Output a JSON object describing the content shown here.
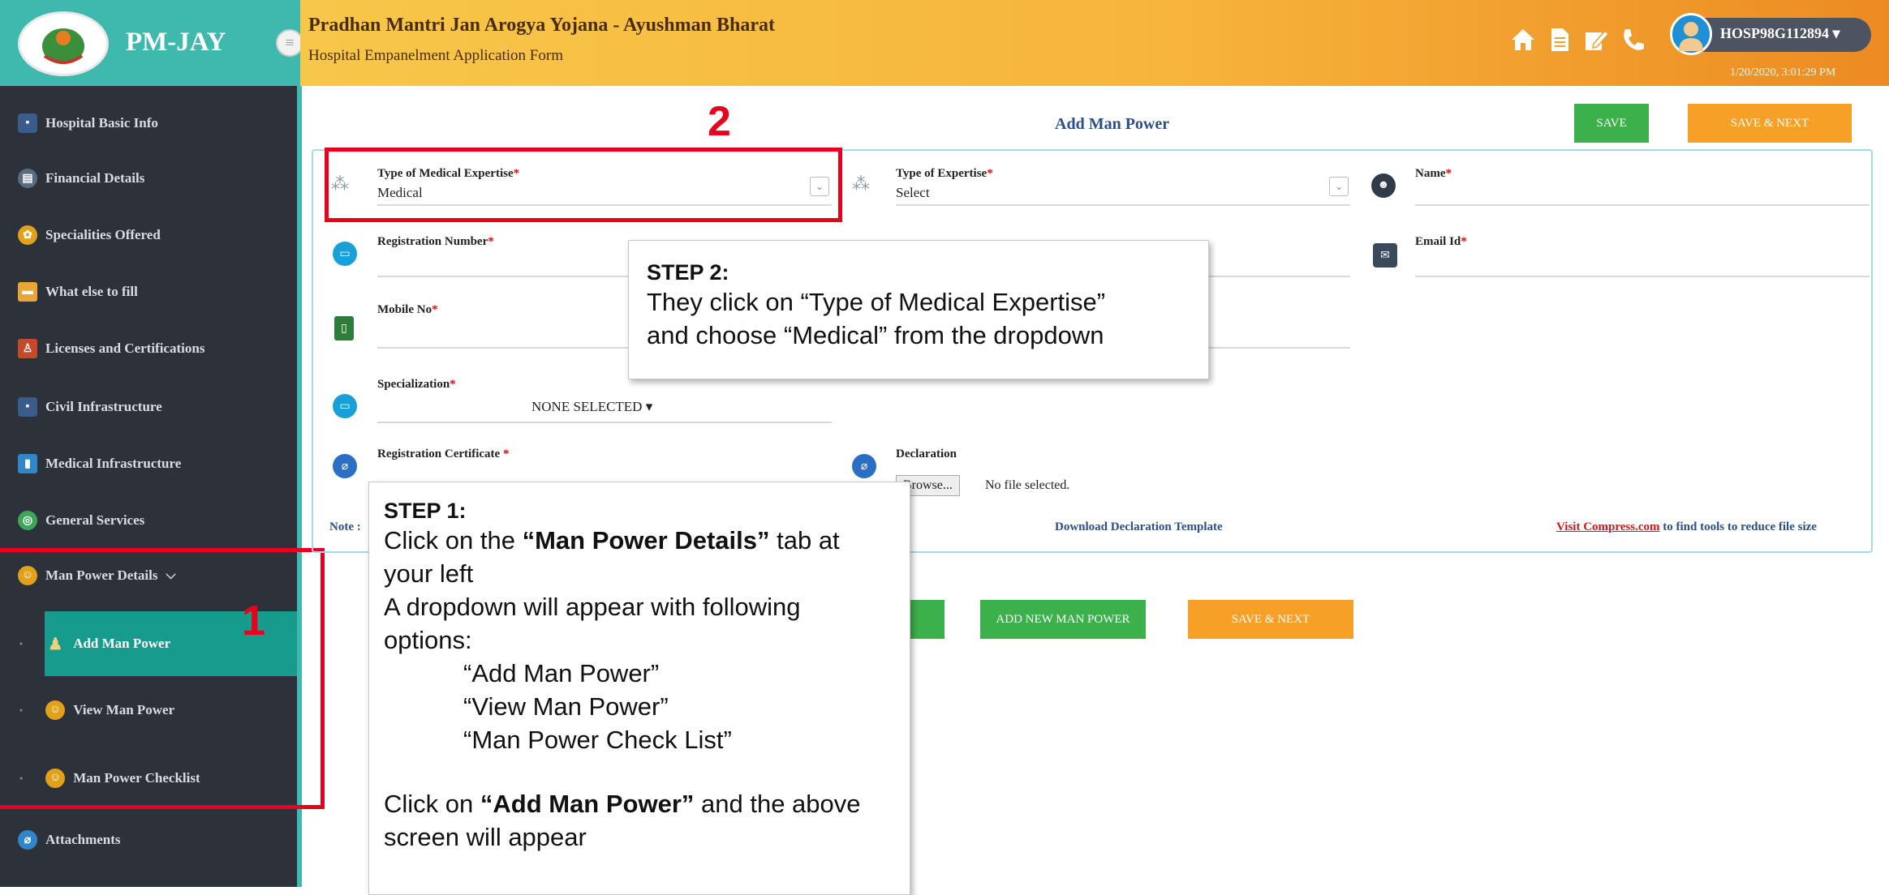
{
  "header": {
    "logo_text": "PM-JAY",
    "title": "Pradhan Mantri Jan Arogya Yojana - Ayushman Bharat",
    "subtitle": "Hospital Empanelment Application Form",
    "user_id": "HOSP98G112894",
    "timestamp": "1/20/2020, 3:01:29 PM",
    "icons": [
      "home-icon",
      "document-icon",
      "edit-icon",
      "phone-icon"
    ]
  },
  "sidebar": {
    "items": [
      {
        "label": "Hospital Basic Info",
        "icon": "hospital-icon"
      },
      {
        "label": "Financial Details",
        "icon": "bank-icon"
      },
      {
        "label": "Specialities Offered",
        "icon": "speciality-icon"
      },
      {
        "label": "What else to fill",
        "icon": "folder-icon"
      },
      {
        "label": "Licenses and Certifications",
        "icon": "certificate-icon"
      },
      {
        "label": "Civil Infrastructure",
        "icon": "building-icon"
      },
      {
        "label": "Medical Infrastructure",
        "icon": "medical-icon"
      },
      {
        "label": "General Services",
        "icon": "services-icon"
      },
      {
        "label": "Man Power Details",
        "icon": "manpower-icon"
      }
    ],
    "sub_items": [
      {
        "label": "Add Man Power",
        "active": true
      },
      {
        "label": "View Man Power",
        "active": false
      },
      {
        "label": "Man Power Checklist",
        "active": false
      }
    ],
    "last_item": "Attachments"
  },
  "form": {
    "title": "Add Man Power",
    "save_label": "SAVE",
    "save_next_label": "SAVE & NEXT",
    "medical_expertise_label": "Type of Medical Expertise",
    "medical_expertise_value": "Medical",
    "expertise_label": "Type of Expertise",
    "expertise_value": "Select",
    "name_label": "Name",
    "registration_label": "Registration Number",
    "email_label": "Email Id",
    "mobile_label": "Mobile No",
    "specialization_label": "Specialization",
    "specialization_value": "NONE SELECTED",
    "reg_certificate_label": "Registration Certificate",
    "declaration_label": "Declaration",
    "browse_label": "Browse...",
    "no_file_label": "No file selected.",
    "note_label": "Note :",
    "download_template_label": "Download Declaration Template",
    "visit_compress_link": "Visit Compress.com",
    "compress_suffix": "to find tools to reduce file size",
    "add_new_label": "ADD NEW MAN POWER",
    "save_next_bottom_label": "SAVE & NEXT",
    "required_mark": "*"
  },
  "annotations": {
    "marker_1": "1",
    "marker_2": "2",
    "step2_head": "STEP 2:",
    "step2_line1": "They click on “Type of Medical Expertise”",
    "step2_line2": "and choose “Medical” from the dropdown",
    "step1_head": "STEP 1:",
    "step1_l1a": "Click on the ",
    "step1_l1b": "“Man Power Details”",
    "step1_l1c": " tab at your left",
    "step1_l2": "A dropdown will appear with following options:",
    "step1_opt1": "“Add Man Power”",
    "step1_opt2": "“View Man Power”",
    "step1_opt3": "“Man Power Check List”",
    "step1_l3a": "Click on ",
    "step1_l3b": "“Add Man Power”",
    "step1_l3c": " and the above screen will appear"
  },
  "colors": {
    "teal": "#3fb9ae",
    "sidebar_bg": "#2d323a",
    "header_orange": "#f7b43c",
    "save_green": "#3cb04a",
    "save_next_orange": "#f6a028",
    "annotation_red": "#e8001c"
  }
}
